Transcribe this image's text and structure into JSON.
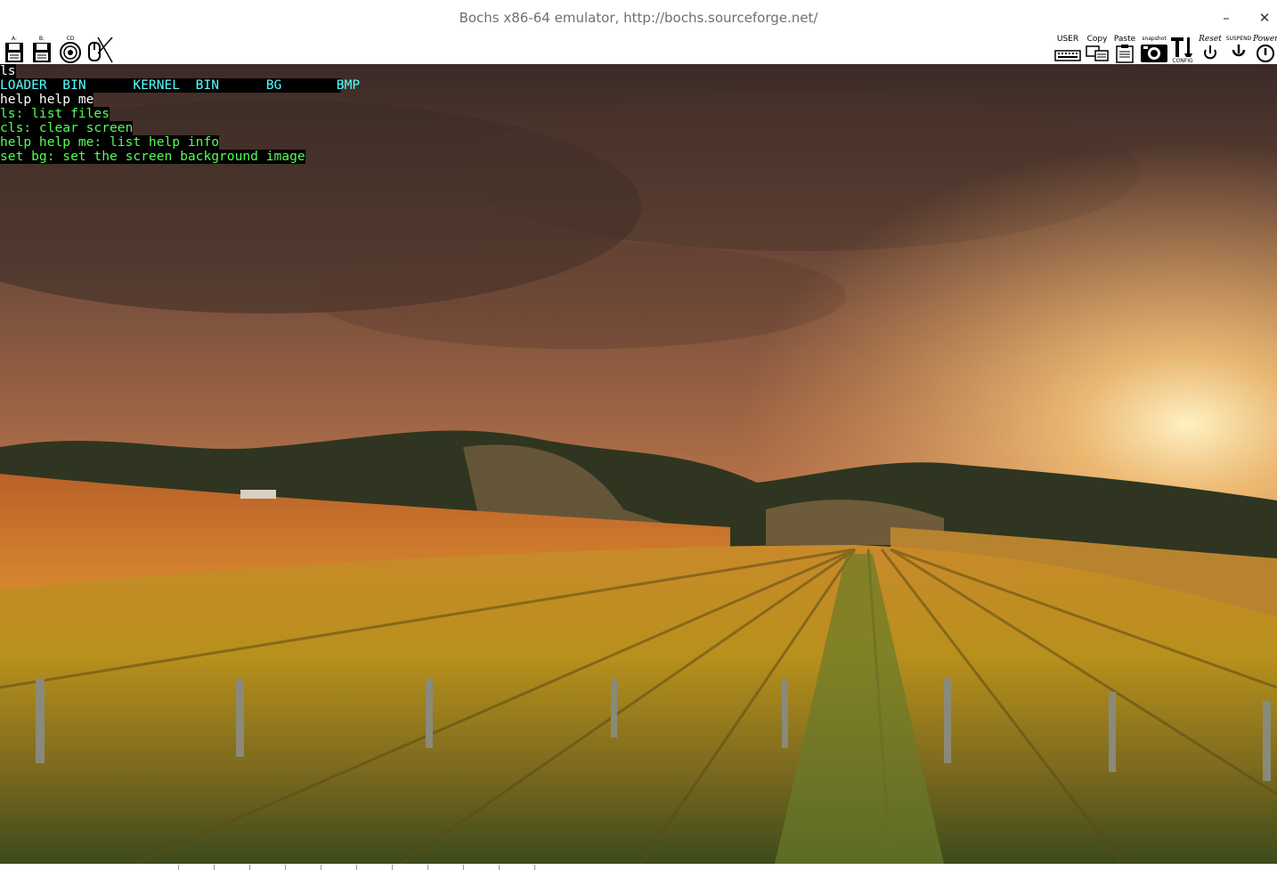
{
  "window": {
    "title": "Bochs x86-64 emulator, http://bochs.sourceforge.net/",
    "minimize_glyph": "–",
    "close_glyph": "✕"
  },
  "toolbar": {
    "floppy_a_label": "A:",
    "floppy_b_label": "B:",
    "cdrom_label": "CD",
    "mouse_label": "",
    "user_label": "USER",
    "copy_label": "Copy",
    "paste_label": "Paste",
    "snapshot_label": "snapshot",
    "config_label": "CONFIG",
    "reset_label": "Reset",
    "suspend_label": "SUSPEND",
    "power_label": "Power",
    "icons": [
      "floppy-a-icon",
      "floppy-b-icon",
      "cdrom-icon",
      "mouse-icon",
      "keyboard-icon",
      "copy-icon",
      "paste-icon",
      "camera-icon",
      "config-icon",
      "reset-icon",
      "suspend-icon",
      "power-icon"
    ]
  },
  "console": {
    "lines": [
      {
        "text": "ls",
        "color": "white"
      },
      {
        "text": "LOADER  BIN      KERNEL  BIN      BG       BMP",
        "color": "cyan"
      },
      {
        "text": "help help me",
        "color": "white"
      },
      {
        "text": "ls: list files",
        "color": "green"
      },
      {
        "text": "cls: clear screen",
        "color": "green"
      },
      {
        "text": "help help me: list help info",
        "color": "green"
      },
      {
        "text": "set bg: set the screen background image",
        "color": "green"
      }
    ],
    "colors": {
      "white": "#ffffff",
      "cyan": "#55ffff",
      "green": "#55ff55",
      "background": "#000000"
    }
  },
  "status_bar": {
    "segments": [
      "",
      "",
      "",
      "",
      "",
      "",
      "",
      "",
      "",
      "",
      ""
    ]
  }
}
